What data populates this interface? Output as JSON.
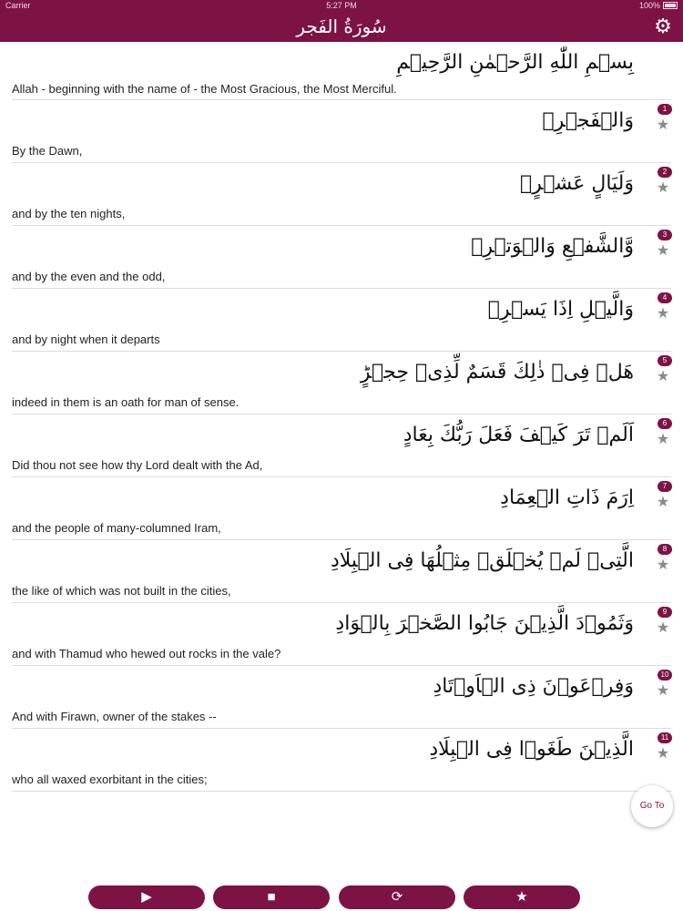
{
  "statusbar": {
    "carrier": "Carrier",
    "time": "5:27 PM",
    "battery": "100%"
  },
  "header": {
    "title": "سُورَةُ الفَجر",
    "settings_icon": "gear-icon"
  },
  "colors": {
    "accent": "#7d1245",
    "star": "#8a8a8a",
    "divider": "#dcdcdc"
  },
  "bismillah": {
    "arabic": "بِسۡمِ اللّٰهِ الرَّحۡمٰنِ الرَّحِيۡمِ",
    "translation": "Allah - beginning with the name of - the Most Gracious, the Most Merciful."
  },
  "verses": [
    {
      "number": "1",
      "arabic": "وَالۡفَجۡرِۙ",
      "translation": "By the Dawn,"
    },
    {
      "number": "2",
      "arabic": "وَلَيَالٍ عَشۡرٍۙ",
      "translation": "and by the ten nights,"
    },
    {
      "number": "3",
      "arabic": "وَّالشَّفۡعِ وَالۡوَتۡرِۙ",
      "translation": "and by the even and the odd,"
    },
    {
      "number": "4",
      "arabic": "وَالَّيۡلِ اِذَا يَسۡرِۚ",
      "translation": "and by night when it departs"
    },
    {
      "number": "5",
      "arabic": "هَلۡ فِىۡ ذٰلِكَ قَسَمٌ لِّذِىۡ حِجۡرٍؕ",
      "translation": "indeed in them is an oath for man of sense."
    },
    {
      "number": "6",
      "arabic": "اَلَمۡ تَرَ كَيۡفَ فَعَلَ رَبُّكَ بِعَادٍ",
      "translation": "Did thou not see how thy Lord dealt with the Ad,"
    },
    {
      "number": "7",
      "arabic": "اِرَمَ ذَاتِ الۡعِمَادِ",
      "translation": "and the people of many-columned Iram,"
    },
    {
      "number": "8",
      "arabic": "الَّتِىۡ لَمۡ يُخۡلَقۡ مِثۡلُهَا فِى الۡبِلَادِ",
      "translation": "the like of which was not built in the cities,"
    },
    {
      "number": "9",
      "arabic": "وَثَمُوۡدَ الَّذِيۡنَ جَابُوا الصَّخۡرَ بِالۡوَادِ",
      "translation": "and with Thamud who hewed out rocks in the vale?"
    },
    {
      "number": "10",
      "arabic": "وَفِرۡعَوۡنَ ذِى الۡاَوۡتَادِ",
      "translation": "And with Firawn, owner of the stakes --"
    },
    {
      "number": "11",
      "arabic": "الَّذِيۡنَ طَغَوۡا فِى الۡبِلَادِ",
      "translation": "who all waxed exorbitant in the cities;"
    }
  ],
  "goto_label": "Go To",
  "controls": {
    "play": "▶",
    "stop": "■",
    "repeat": "⟳",
    "favorites": "★"
  },
  "star_glyph": "★"
}
